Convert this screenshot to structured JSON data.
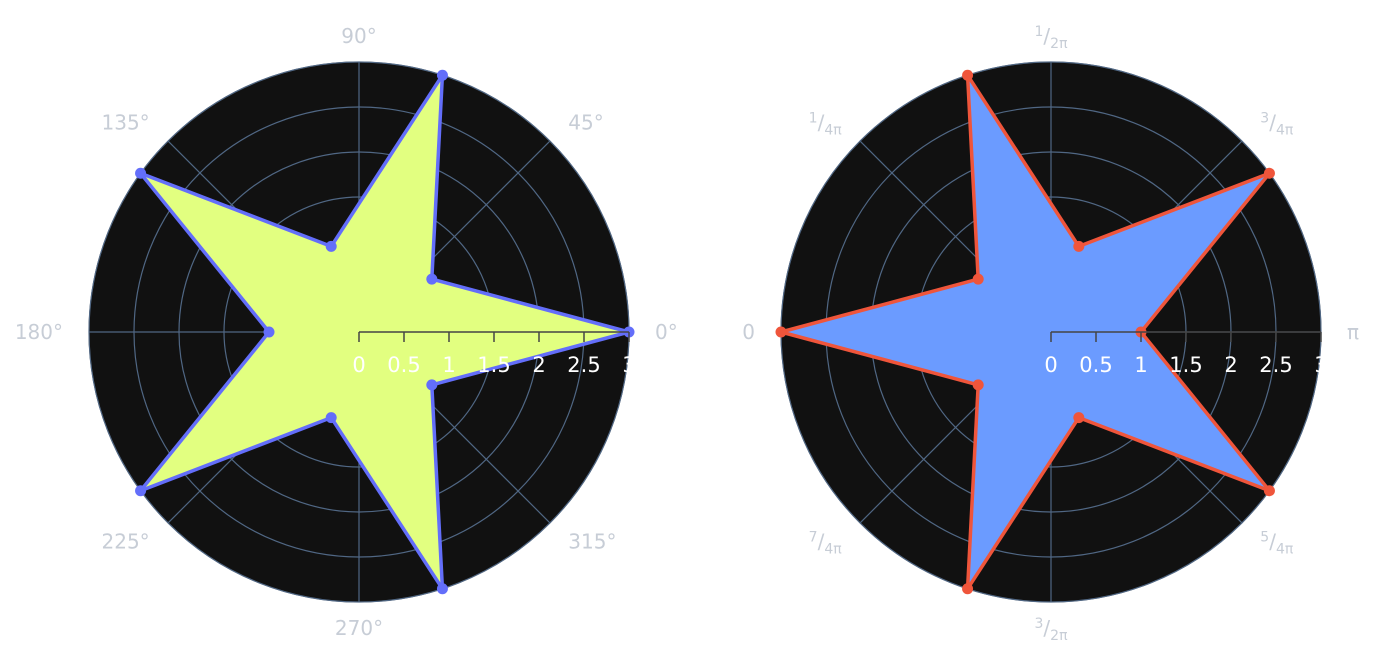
{
  "chart_data": [
    {
      "type": "polar-area",
      "angular_unit": "degrees",
      "angular_ticks": [
        {
          "angle": 0,
          "label": "0°"
        },
        {
          "angle": 45,
          "label": "45°"
        },
        {
          "angle": 90,
          "label": "90°"
        },
        {
          "angle": 135,
          "label": "135°"
        },
        {
          "angle": 180,
          "label": "180°"
        },
        {
          "angle": 225,
          "label": "225°"
        },
        {
          "angle": 270,
          "label": "270°"
        },
        {
          "angle": 315,
          "label": "315°"
        }
      ],
      "radial_ticks": [
        "0",
        "0.5",
        "1",
        "1.5",
        "2",
        "2.5",
        "3"
      ],
      "rlim": [
        0,
        3
      ],
      "grid": true,
      "background_color": "#111111",
      "grid_color": "#506784",
      "series": [
        {
          "theta": [
            0,
            36,
            72,
            108,
            144,
            180,
            216,
            252,
            288,
            324,
            360
          ],
          "r": [
            3,
            1,
            3,
            1,
            3,
            1,
            3,
            1,
            3,
            1,
            3
          ],
          "fill_color": "#e2ff80",
          "line_color": "#636efa"
        }
      ]
    },
    {
      "type": "polar-area",
      "angular_unit": "radians",
      "angular_ticks": [
        {
          "angle": 0,
          "label": "π",
          "num": "",
          "den": ""
        },
        {
          "angle": 45,
          "label": "3/4π",
          "num": "3",
          "den": "4"
        },
        {
          "angle": 90,
          "label": "1/2π",
          "num": "1",
          "den": "2"
        },
        {
          "angle": 135,
          "label": "1/4π",
          "num": "1",
          "den": "4"
        },
        {
          "angle": 180,
          "label": "0",
          "num": "",
          "den": ""
        },
        {
          "angle": 225,
          "label": "7/4π",
          "num": "7",
          "den": "4"
        },
        {
          "angle": 270,
          "label": "3/2π",
          "num": "3",
          "den": "2"
        },
        {
          "angle": 315,
          "label": "5/4π",
          "num": "5",
          "den": "4"
        }
      ],
      "radial_ticks": [
        "0",
        "0.5",
        "1",
        "1.5",
        "2",
        "2.5",
        "3"
      ],
      "rlim": [
        0,
        3
      ],
      "grid": true,
      "background_color": "#111111",
      "grid_color": "#506784",
      "series": [
        {
          "theta_deg": [
            0,
            36,
            72,
            108,
            144,
            180,
            216,
            252,
            288,
            324,
            360
          ],
          "r": [
            1,
            3,
            1,
            3,
            1,
            3,
            1,
            3,
            1,
            3,
            1
          ],
          "fill_color": "#6b9bff",
          "line_color": "#ef553b"
        }
      ]
    }
  ]
}
